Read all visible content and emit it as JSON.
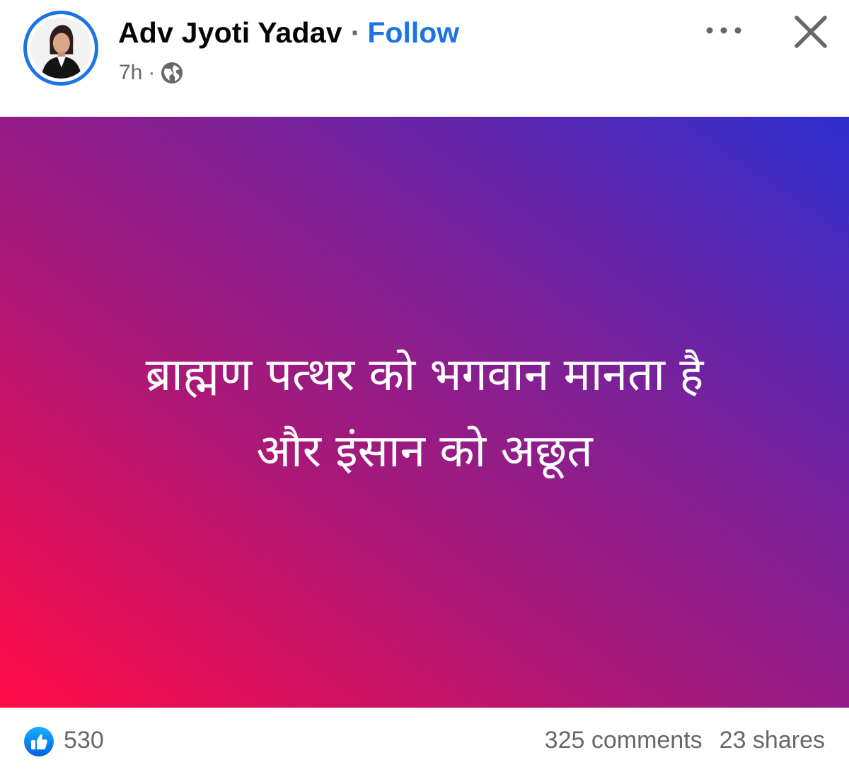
{
  "post": {
    "author": {
      "name": "Adv Jyoti Yadav",
      "follow_label": "Follow",
      "separator": "·"
    },
    "meta": {
      "timestamp": "7h",
      "separator": "·",
      "audience_icon": "globe-icon"
    },
    "header_actions": {
      "more_icon": "more-options-icon",
      "close_icon": "close-icon"
    },
    "content": {
      "lines": [
        "ब्राह्मण पत्थर को भगवान मानता है",
        "और इंसान को अछूत"
      ],
      "background_gradient": [
        "#ff0a45",
        "#a6197a",
        "#7a2199",
        "#2f2fcf"
      ],
      "text_color": "#ffffff"
    },
    "stats": {
      "reaction_icon": "like-icon",
      "reaction_count": "530",
      "comments": "325 comments",
      "shares": "23 shares"
    }
  },
  "colors": {
    "accent": "#1b74e4",
    "secondary_text": "#65676b",
    "primary_text": "#050505"
  }
}
